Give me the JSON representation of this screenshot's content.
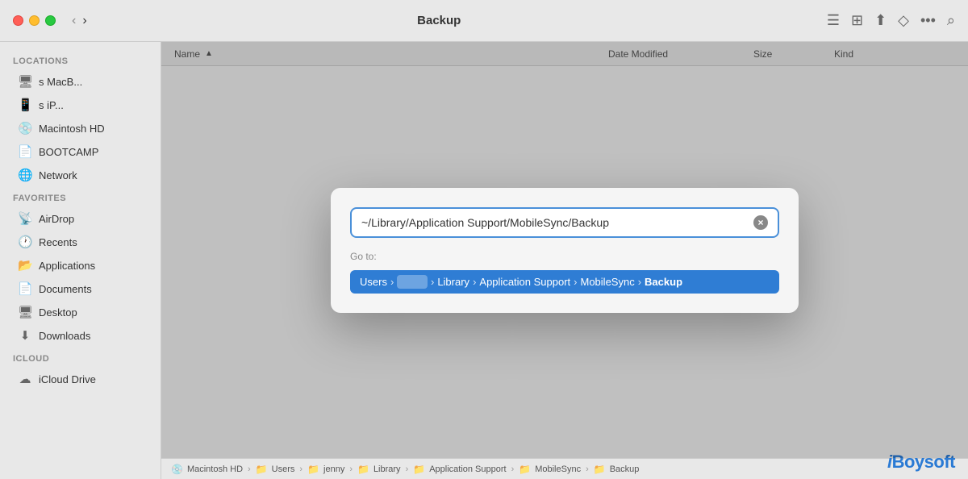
{
  "titlebar": {
    "title": "Backup",
    "back_label": "‹",
    "forward_label": "›"
  },
  "toolbar": {
    "list_icon": "☰",
    "grid_icon": "⊞",
    "share_icon": "⬆",
    "tag_icon": "◇",
    "more_icon": "•••",
    "search_icon": "⌕"
  },
  "columns": {
    "name": "Name",
    "date_modified": "Date Modified",
    "size": "Size",
    "kind": "Kind"
  },
  "sidebar": {
    "locations_label": "Locations",
    "favorites_label": "Favorites",
    "icloud_label": "iCloud",
    "items": [
      {
        "id": "macbook",
        "label": "s MacB...",
        "icon": "🖥",
        "section": "locations"
      },
      {
        "id": "iphone",
        "label": "s iP...",
        "icon": "📱",
        "section": "locations"
      },
      {
        "id": "macintosh-hd",
        "label": "Macintosh HD",
        "icon": "💿",
        "section": "locations"
      },
      {
        "id": "bootcamp",
        "label": "BOOTCAMP",
        "icon": "📄",
        "section": "locations"
      },
      {
        "id": "network",
        "label": "Network",
        "icon": "🌐",
        "section": "locations"
      },
      {
        "id": "airdrop",
        "label": "AirDrop",
        "icon": "📡",
        "section": "favorites"
      },
      {
        "id": "recents",
        "label": "Recents",
        "icon": "🕐",
        "section": "favorites"
      },
      {
        "id": "applications",
        "label": "Applications",
        "icon": "📂",
        "section": "favorites"
      },
      {
        "id": "documents",
        "label": "Documents",
        "icon": "📄",
        "section": "favorites"
      },
      {
        "id": "desktop",
        "label": "Desktop",
        "icon": "🖥",
        "section": "favorites"
      },
      {
        "id": "downloads",
        "label": "Downloads",
        "icon": "⬇",
        "section": "favorites"
      },
      {
        "id": "icloud-drive",
        "label": "iCloud Drive",
        "icon": "☁",
        "section": "icloud"
      }
    ]
  },
  "modal": {
    "input_value": "~/Library/Application Support/MobileSync/Backup",
    "goto_label": "Go to:",
    "clear_button": "×",
    "path": {
      "users": "Users",
      "username": "",
      "library": "Library",
      "app_support": "Application Support",
      "mobilesync": "MobileSync",
      "backup": "Backup"
    }
  },
  "status_bar": {
    "breadcrumb": [
      {
        "label": "Macintosh HD",
        "icon": "💿"
      },
      {
        "label": "Users",
        "icon": "📁"
      },
      {
        "label": "jenny",
        "icon": "📁"
      },
      {
        "label": "Library",
        "icon": "📁"
      },
      {
        "label": "Application Support",
        "icon": "📁"
      },
      {
        "label": "MobileSync",
        "icon": "📁"
      },
      {
        "label": "Backup",
        "icon": "📁"
      }
    ]
  },
  "watermark": {
    "text": "iBoysoft",
    "i_prefix": "i"
  }
}
